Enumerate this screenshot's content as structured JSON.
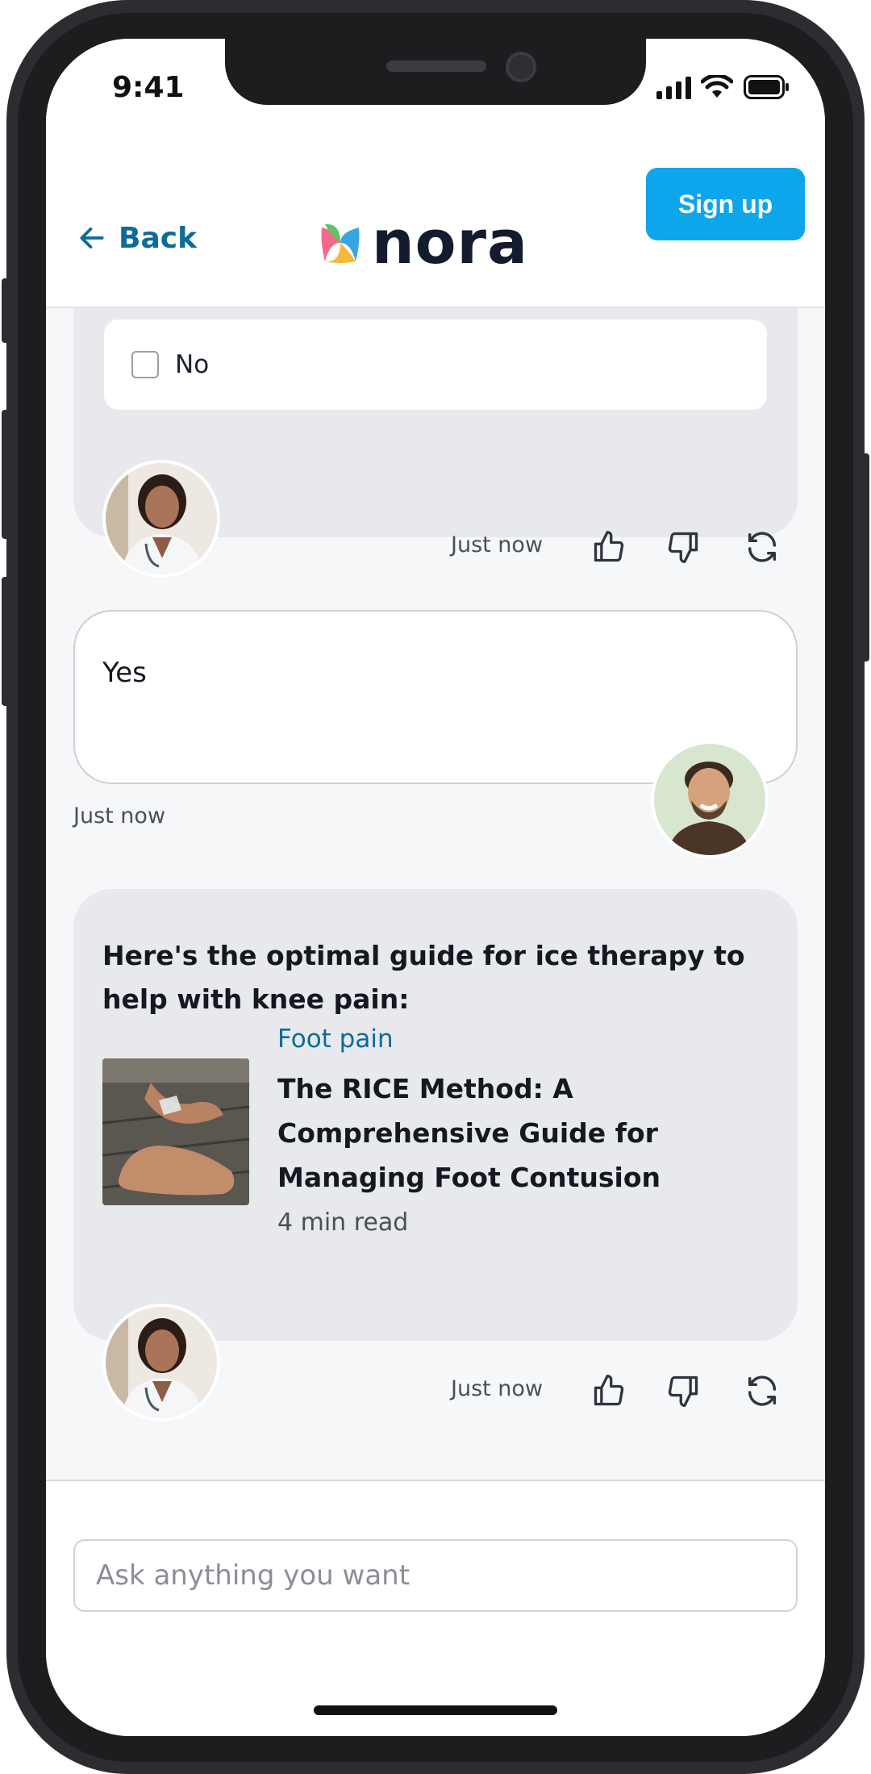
{
  "status_bar": {
    "time": "9:41"
  },
  "header": {
    "back_label": "Back",
    "logo_text": "nora",
    "signup_label": "Sign up"
  },
  "question_card": {
    "options": [
      {
        "label": "No",
        "checked": false
      }
    ],
    "timestamp": "Just now"
  },
  "user_message": {
    "text": "Yes",
    "timestamp": "Just now"
  },
  "ai_message": {
    "intro": "Here's the optimal guide for ice therapy to help with knee pain:",
    "article": {
      "category": "Foot pain",
      "title": "The RICE Method: A Comprehensive Guide for Managing Foot Contusion",
      "read_time": "4 min read"
    },
    "timestamp": "Just now"
  },
  "composer": {
    "placeholder": "Ask anything you want"
  },
  "colors": {
    "accent": "#0ea6ea",
    "link": "#0d6b97",
    "bubble": "#e8e9ed"
  },
  "icons": [
    "back-arrow-icon",
    "thumbs-up-icon",
    "thumbs-down-icon",
    "refresh-icon",
    "checkbox-icon",
    "signal-icon",
    "wifi-icon",
    "battery-icon"
  ]
}
